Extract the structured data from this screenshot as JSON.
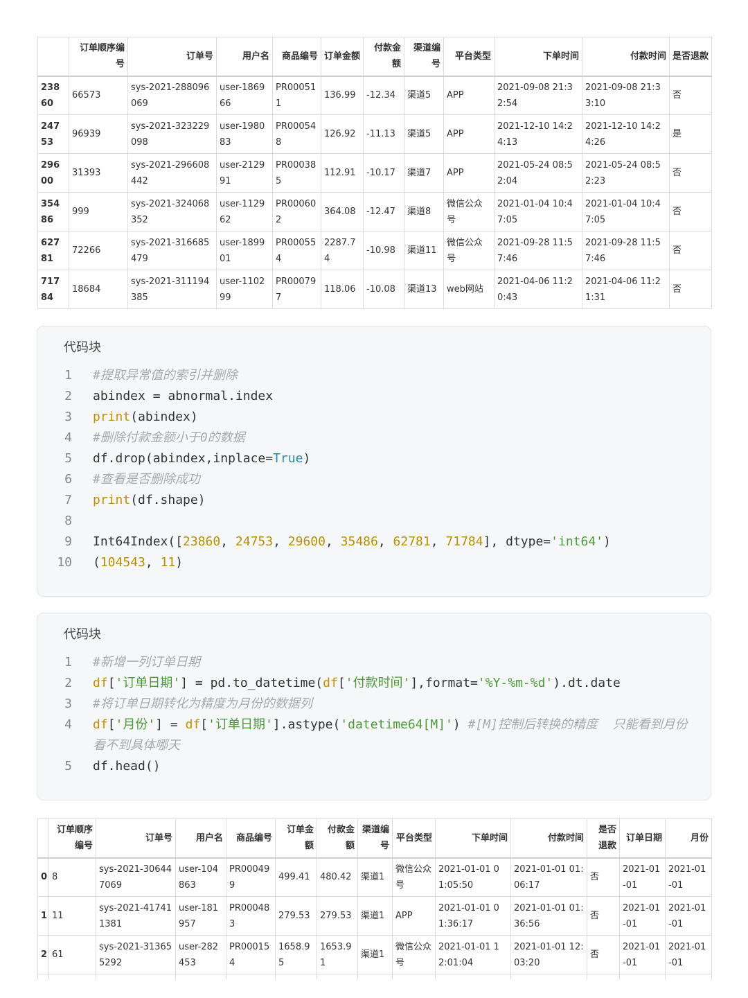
{
  "table1": {
    "headers": [
      "",
      "订单顺序编号",
      "订单号",
      "用户名",
      "商品编号",
      "订单金额",
      "付款金额",
      "渠道编号",
      "平台类型",
      "下单时间",
      "付款时间",
      "是否退款"
    ],
    "rows": [
      [
        "23860",
        "66573",
        "sys-2021-288096069",
        "user-186966",
        "PR000511",
        "136.99",
        "-12.34",
        "渠道5",
        "APP",
        "2021-09-08 21:32:54",
        "2021-09-08 21:33:10",
        "否"
      ],
      [
        "24753",
        "96939",
        "sys-2021-323229098",
        "user-198083",
        "PR000548",
        "126.92",
        "-11.13",
        "渠道5",
        "APP",
        "2021-12-10 14:24:13",
        "2021-12-10 14:24:26",
        "是"
      ],
      [
        "29600",
        "31393",
        "sys-2021-296608442",
        "user-212991",
        "PR000385",
        "112.91",
        "-10.17",
        "渠道7",
        "APP",
        "2021-05-24 08:52:04",
        "2021-05-24 08:52:23",
        "否"
      ],
      [
        "35486",
        "999",
        "sys-2021-324068352",
        "user-112962",
        "PR000602",
        "364.08",
        "-12.47",
        "渠道8",
        "微信公众号",
        "2021-01-04 10:47:05",
        "2021-01-04 10:47:05",
        "否"
      ],
      [
        "62781",
        "72266",
        "sys-2021-316685479",
        "user-189901",
        "PR000554",
        "2287.74",
        "-10.98",
        "渠道11",
        "微信公众号",
        "2021-09-28 11:57:46",
        "2021-09-28 11:57:46",
        "否"
      ],
      [
        "71784",
        "18684",
        "sys-2021-311194385",
        "user-110299",
        "PR000797",
        "118.06",
        "-10.08",
        "渠道13",
        "web网站",
        "2021-04-06 11:20:43",
        "2021-04-06 11:21:31",
        "否"
      ]
    ]
  },
  "code1": {
    "title": "代码块",
    "lines": [
      {
        "n": "1",
        "segs": [
          {
            "t": "#提取异常值的索引并删除",
            "c": "cm"
          }
        ]
      },
      {
        "n": "2",
        "segs": [
          {
            "t": "abindex = abnormal.index",
            "c": ""
          }
        ]
      },
      {
        "n": "3",
        "segs": [
          {
            "t": "print",
            "c": "fn"
          },
          {
            "t": "(abindex)",
            "c": ""
          }
        ]
      },
      {
        "n": "4",
        "segs": [
          {
            "t": "#删除付款金额小于0的数据",
            "c": "cm"
          }
        ]
      },
      {
        "n": "5",
        "segs": [
          {
            "t": "df.drop(abindex,inplace=",
            "c": ""
          },
          {
            "t": "True",
            "c": "kw"
          },
          {
            "t": ")",
            "c": ""
          }
        ]
      },
      {
        "n": "6",
        "segs": [
          {
            "t": "#查看是否删除成功",
            "c": "cm"
          }
        ]
      },
      {
        "n": "7",
        "segs": [
          {
            "t": "print",
            "c": "fn"
          },
          {
            "t": "(df.shape)",
            "c": ""
          }
        ]
      },
      {
        "n": "8",
        "segs": [
          {
            "t": "",
            "c": ""
          }
        ]
      },
      {
        "n": "9",
        "segs": [
          {
            "t": "Int64Index([",
            "c": ""
          },
          {
            "t": "23860",
            "c": "num"
          },
          {
            "t": ", ",
            "c": ""
          },
          {
            "t": "24753",
            "c": "num"
          },
          {
            "t": ", ",
            "c": ""
          },
          {
            "t": "29600",
            "c": "num"
          },
          {
            "t": ", ",
            "c": ""
          },
          {
            "t": "35486",
            "c": "num"
          },
          {
            "t": ", ",
            "c": ""
          },
          {
            "t": "62781",
            "c": "num"
          },
          {
            "t": ", ",
            "c": ""
          },
          {
            "t": "71784",
            "c": "num"
          },
          {
            "t": "], dtype=",
            "c": ""
          },
          {
            "t": "'int64'",
            "c": "str"
          },
          {
            "t": ")",
            "c": ""
          }
        ]
      },
      {
        "n": "10",
        "segs": [
          {
            "t": "(",
            "c": ""
          },
          {
            "t": "104543",
            "c": "num"
          },
          {
            "t": ", ",
            "c": ""
          },
          {
            "t": "11",
            "c": "num"
          },
          {
            "t": ")",
            "c": ""
          }
        ]
      }
    ]
  },
  "code2": {
    "title": "代码块",
    "lines": [
      {
        "n": "1",
        "segs": [
          {
            "t": "#新增一列订单日期",
            "c": "cm"
          }
        ]
      },
      {
        "n": "2",
        "segs": [
          {
            "t": "df",
            "c": "fn"
          },
          {
            "t": "[",
            "c": ""
          },
          {
            "t": "'订单日期'",
            "c": "str"
          },
          {
            "t": "] = pd.to_datetime(",
            "c": ""
          },
          {
            "t": "df",
            "c": "fn"
          },
          {
            "t": "[",
            "c": ""
          },
          {
            "t": "'付款时间'",
            "c": "str"
          },
          {
            "t": "],format=",
            "c": ""
          },
          {
            "t": "'%Y-%m-%d'",
            "c": "str"
          },
          {
            "t": ").dt.date",
            "c": ""
          }
        ]
      },
      {
        "n": "3",
        "segs": [
          {
            "t": "#将订单日期转化为精度为月份的数据列",
            "c": "cm"
          }
        ]
      },
      {
        "n": "4",
        "segs": [
          {
            "t": "df",
            "c": "fn"
          },
          {
            "t": "[",
            "c": ""
          },
          {
            "t": "'月份'",
            "c": "str"
          },
          {
            "t": "] = ",
            "c": ""
          },
          {
            "t": "df",
            "c": "fn"
          },
          {
            "t": "[",
            "c": ""
          },
          {
            "t": "'订单日期'",
            "c": "str"
          },
          {
            "t": "].astype(",
            "c": ""
          },
          {
            "t": "'datetime64[M]'",
            "c": "str"
          },
          {
            "t": ") ",
            "c": ""
          },
          {
            "t": "#[M]控制后转换的精度  只能看到月份 看不到具体哪天",
            "c": "cm"
          }
        ]
      },
      {
        "n": "5",
        "segs": [
          {
            "t": "df.head()",
            "c": ""
          }
        ]
      }
    ]
  },
  "table2": {
    "headers": [
      "",
      "订单顺序编号",
      "订单号",
      "用户名",
      "商品编号",
      "订单金额",
      "付款金额",
      "渠道编号",
      "平台类型",
      "下单时间",
      "付款时间",
      "是否退款",
      "订单日期",
      "月份"
    ],
    "rows": [
      [
        "0",
        "8",
        "sys-2021-306447069",
        "user-104863",
        "PR000499",
        "499.41",
        "480.42",
        "渠道1",
        "微信公众号",
        "2021-01-01 01:05:50",
        "2021-01-01 01:06:17",
        "否",
        "2021-01-01",
        "2021-01-01"
      ],
      [
        "1",
        "11",
        "sys-2021-417411381",
        "user-181957",
        "PR000483",
        "279.53",
        "279.53",
        "渠道1",
        "APP",
        "2021-01-01 01:36:17",
        "2021-01-01 01:36:56",
        "否",
        "2021-01-01",
        "2021-01-01"
      ],
      [
        "2",
        "61",
        "sys-2021-313655292",
        "user-282453",
        "PR000154",
        "1658.95",
        "1653.91",
        "渠道1",
        "微信公众号",
        "2021-01-01 12:01:04",
        "2021-01-01 12:03:20",
        "否",
        "2021-01-01",
        "2021-01-01"
      ],
      [
        "",
        "",
        "",
        "",
        "",
        "",
        "",
        "",
        "",
        "",
        "",
        "",
        "",
        ""
      ]
    ]
  }
}
